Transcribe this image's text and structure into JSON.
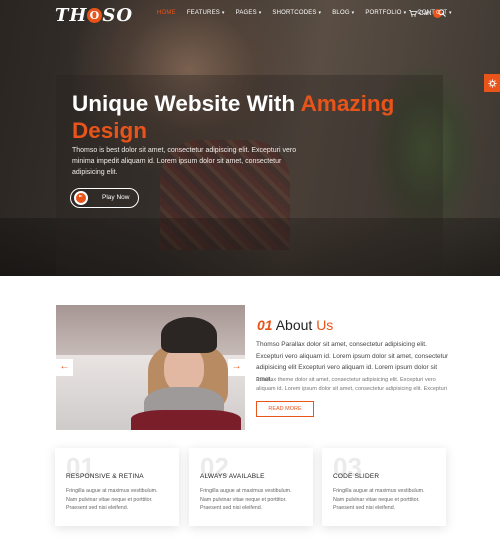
{
  "colors": {
    "accent": "#e8541a",
    "hero_bg": "#3a3530",
    "text_dark": "#222222"
  },
  "nav": {
    "logo": {
      "left": "TH",
      "circle": "O",
      "right": "SO"
    },
    "menu": [
      {
        "label": "HOME",
        "active": true
      },
      {
        "label": "FEATURES",
        "active": false
      },
      {
        "label": "PAGES",
        "active": false
      },
      {
        "label": "SHORTCODES",
        "active": false
      },
      {
        "label": "BLOG",
        "active": false
      },
      {
        "label": "PORTFOLIO",
        "active": false
      },
      {
        "label": "CONTACT",
        "active": false
      }
    ],
    "cart_label": "Cart",
    "cart_count": "0"
  },
  "hero": {
    "title_line1_plain": "Unique Website With ",
    "title_line1_accent": "Amazing",
    "title_line2_accent": "Design",
    "description": "Thomso is best dolor sit amet, consectetur adipiscing elit. Excepturi vero minima impedit aliquam id. Lorem ipsum dolor sit amet, consectetur adipisicing elit.",
    "play_label": "Play Now"
  },
  "about": {
    "number": "01",
    "title_plain": "About ",
    "title_accent": "Us",
    "paragraph1": "Thomso Parallax dolor sit amet, consectetur adipisicing elit. Excepturi vero aliquam id. Lorem ipsum dolor sit amet, consectetur adipisicing elit Excepturi vero aliquam id. Lorem ipsum dolor sit amet.",
    "paragraph2": "Parallax theme dolor sit amet, consectetur adipisicing elit. Excepturi vero aliquam id. Lorem ipsum dolor sit amet, consectetur adipisicing elit. Excepturi",
    "read_more": "READ MORE",
    "prev_arrow": "←",
    "next_arrow": "→"
  },
  "features": [
    {
      "number": "01",
      "title": "RESPONSIVE & RETINA",
      "text": "Fringilla augue at maximus vestibulum. Nam pulvinar vitae neque et porttitor. Praesent sed nisi eleifend."
    },
    {
      "number": "02",
      "title": "ALWAYS AVAILABLE",
      "text": "Fringilla augue at maximus vestibulum. Nam pulvinar vitae neque et porttitor. Praesent sed nisi eleifend."
    },
    {
      "number": "03",
      "title": "CODE SLIDER",
      "text": "Fringilla augue at maximus vestibulum. Nam pulvinar vitae neque et porttitor. Praesent sed nisi eleifend."
    }
  ]
}
